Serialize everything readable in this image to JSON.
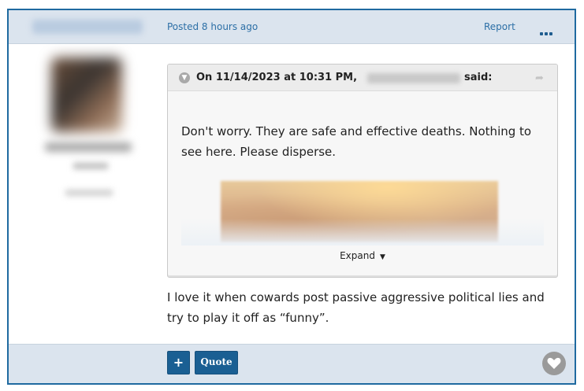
{
  "post": {
    "posted_label": "Posted 8 hours ago",
    "report_label": "Report",
    "more_icon": "ellipsis-icon"
  },
  "quote": {
    "header_prefix": "On 11/14/2023 at 10:31 PM,",
    "header_suffix": "said:",
    "body": "Don't worry. They are safe and effective deaths. Nothing to see here. Please disperse.",
    "expand_label": "Expand",
    "toggle_icon": "chevron-down-circle-icon",
    "jump_icon": "share-arrow-icon"
  },
  "message": {
    "text": "I love it when cowards post passive aggressive political lies and try to play it off as “funny”."
  },
  "actions": {
    "plus_label": "+",
    "quote_label": "Quote",
    "reaction_icon": "heart-icon"
  },
  "colors": {
    "accent": "#1a5f93",
    "link": "#2c6fa6",
    "band": "#dbe4ee",
    "border": "#1f6aa0"
  }
}
